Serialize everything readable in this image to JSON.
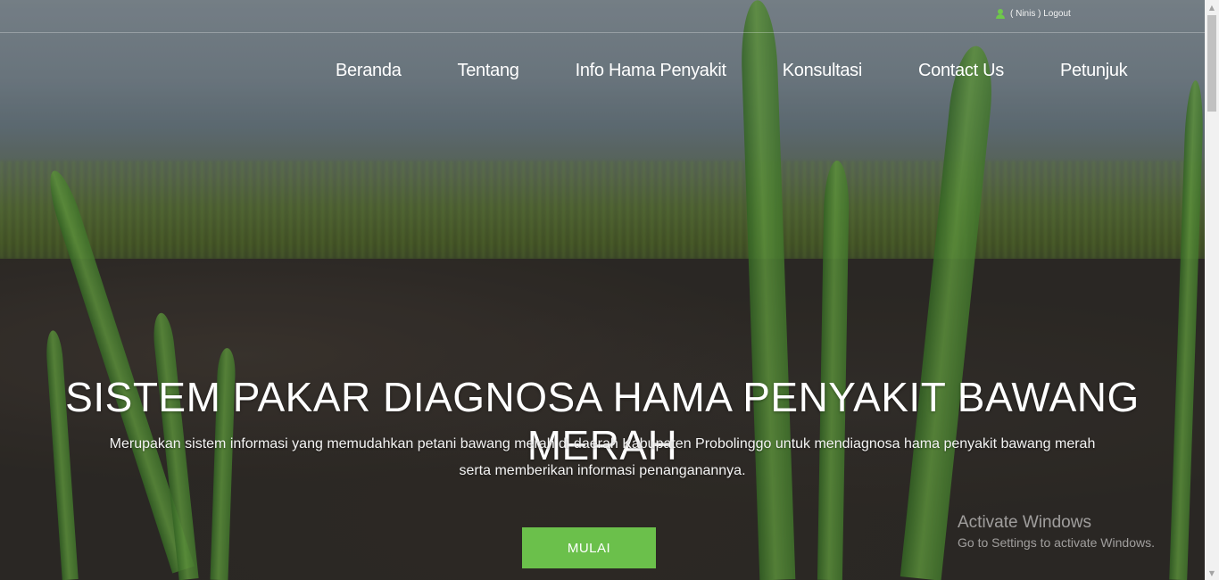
{
  "header": {
    "user_logout": "( Ninis ) Logout",
    "user_icon": "user-icon"
  },
  "nav": {
    "items": [
      {
        "label": "Beranda"
      },
      {
        "label": "Tentang"
      },
      {
        "label": "Info Hama Penyakit"
      },
      {
        "label": "Konsultasi"
      },
      {
        "label": "Contact Us"
      },
      {
        "label": "Petunjuk"
      }
    ]
  },
  "hero": {
    "title": "SISTEM PAKAR DIAGNOSA HAMA PENYAKIT BAWANG MERAH",
    "subtitle": "Merupakan sistem informasi yang memudahkan petani bawang merah di daerah Kabupaten Probolinggo untuk mendiagnosa hama penyakit bawang merah serta memberikan informasi penanganannya.",
    "button_label": "MULAI"
  },
  "watermark": {
    "title": "Activate Windows",
    "subtitle": "Go to Settings to activate Windows."
  },
  "colors": {
    "accent": "#6bc04b",
    "text": "#ffffff"
  }
}
